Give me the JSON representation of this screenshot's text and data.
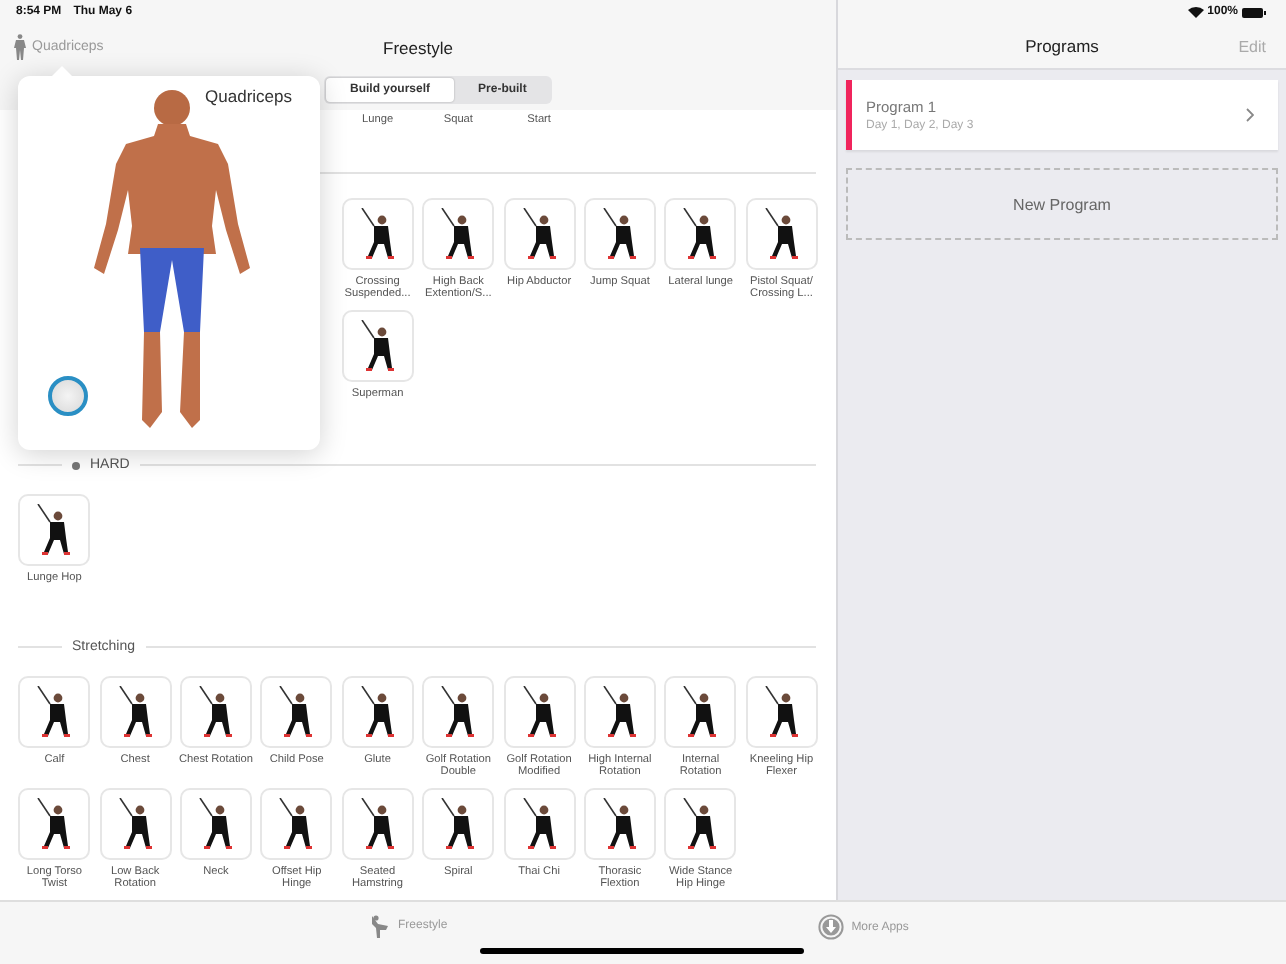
{
  "status_bar": {
    "time": "8:54 PM",
    "date": "Thu May 6",
    "battery": "100%"
  },
  "nav": {
    "muscle_button": "Quadriceps",
    "title": "Freestyle"
  },
  "segments": [
    {
      "label": "Build yourself",
      "selected": true
    },
    {
      "label": "Pre-built",
      "selected": false
    }
  ],
  "top_labels": [
    "Lunge",
    "Squat",
    "Start"
  ],
  "sections": [
    {
      "kind": "untitled",
      "items": [
        "Crossing Suspended...",
        "High Back Extention/S...",
        "Hip Abductor",
        "Jump Squat",
        "Lateral lunge",
        "Pistol Squat/ Crossing L...",
        "Superman"
      ]
    },
    {
      "kind": "level",
      "title": "HARD",
      "items": [
        "Lunge Hop"
      ]
    },
    {
      "kind": "category",
      "title": "Stretching",
      "items": [
        "Calf",
        "Chest",
        "Chest Rotation",
        "Child Pose",
        "Glute",
        "Golf Rotation Double",
        "Golf Rotation Modified",
        "High Internal Rotation",
        "Internal Rotation",
        "Kneeling Hip Flexer",
        "Long Torso Twist",
        "Low Back Rotation",
        "Neck",
        "Offset Hip Hinge",
        "Seated Hamstring",
        "Spiral",
        "Thai Chi",
        "Thorasic Flextion",
        "Wide Stance Hip Hinge"
      ]
    }
  ],
  "popover": {
    "title": "Quadriceps"
  },
  "programs_panel": {
    "title": "Programs",
    "edit": "Edit",
    "programs": [
      {
        "name": "Program 1",
        "days": "Day 1, Day 2, Day 3",
        "color": "#f0245c"
      }
    ],
    "new_program": "New Program"
  },
  "tab_bar": [
    {
      "kind": "freestyle",
      "label": "Freestyle"
    },
    {
      "kind": "more-apps",
      "label": "More Apps"
    }
  ]
}
